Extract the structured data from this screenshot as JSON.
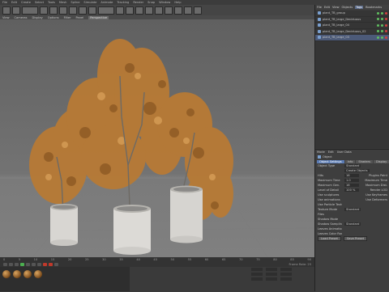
{
  "menubar": [
    "File",
    "Edit",
    "Create",
    "Select",
    "Tools",
    "Mesh",
    "Spline",
    "Simulate",
    "Animate",
    "Tracking",
    "Render",
    "Snap",
    "Window",
    "Help"
  ],
  "viewport_menu": {
    "items": [
      "View",
      "Cameras",
      "Display",
      "Options",
      "Filter",
      "Panel"
    ],
    "active_tag": "Perspective"
  },
  "object_manager": {
    "menu": [
      "File",
      "Edit",
      "View",
      "Objects",
      "Tags",
      "Bookmarks"
    ],
    "active_menu": "Tags",
    "objects": [
      {
        "name": "plant_TB_group",
        "selected": false
      },
      {
        "name": "plant_TB_large_Deciduous",
        "selected": false
      },
      {
        "name": "plant_TB_large_04",
        "selected": false
      },
      {
        "name": "plant_TB_large_Deciduous_02",
        "selected": false
      },
      {
        "name": "plant_TB_large_03",
        "selected": true
      }
    ]
  },
  "attributes": {
    "menu": [
      "Mode",
      "Edit",
      "User Data"
    ],
    "title": "Object",
    "tabs": [
      "Object Settings",
      "Info",
      "Shaders",
      "Display"
    ],
    "rows": [
      {
        "k": "Object Type",
        "v": "Standard",
        "k2": ""
      },
      {
        "k": "",
        "v": "Create Objects",
        "k2": ""
      },
      {
        "k": "Hits",
        "v": "16",
        "k2": "Plugins Paint"
      },
      {
        "k": "Maximum Time",
        "v": "1.0",
        "k2": "Maximum Time"
      },
      {
        "k": "Maximum Gen.",
        "v": "16",
        "k2": "Maximum Dist."
      },
      {
        "k": "Level of Detail",
        "v": "100 %",
        "k2": "Render LOD"
      },
      {
        "k": "Use sculptures",
        "v": "",
        "k2": "Use Keyframes"
      },
      {
        "k": "Use animations",
        "v": "",
        "k2": "Use Deformers"
      },
      {
        "k": "Use Particle Texture",
        "v": "",
        "k2": ""
      },
      {
        "k": "Texture Mode",
        "v": "Standard",
        "k2": ""
      },
      {
        "k": "Files",
        "v": "",
        "k2": ""
      },
      {
        "k": "Shadow Mode",
        "v": "",
        "k2": ""
      },
      {
        "k": "Shadow Sampling",
        "v": "Standard",
        "k2": ""
      },
      {
        "k": "Leaves Animation",
        "v": "",
        "k2": ""
      },
      {
        "k": "Leaves Color Random",
        "v": "",
        "k2": ""
      }
    ],
    "buttons": [
      "Load Preset",
      "Save Preset"
    ]
  },
  "timeline": {
    "ticks": [
      "0",
      "5",
      "10",
      "15",
      "20",
      "25",
      "30",
      "35",
      "40",
      "45",
      "50",
      "55",
      "60",
      "65",
      "70",
      "75",
      "80",
      "85",
      "90"
    ],
    "frame_label": "Frame Rate: 25"
  },
  "colors": {
    "foliage": "#b87a35",
    "pot": "#d8d6d2",
    "selection": "#4c5a78",
    "accent": "#5b7cb5"
  }
}
